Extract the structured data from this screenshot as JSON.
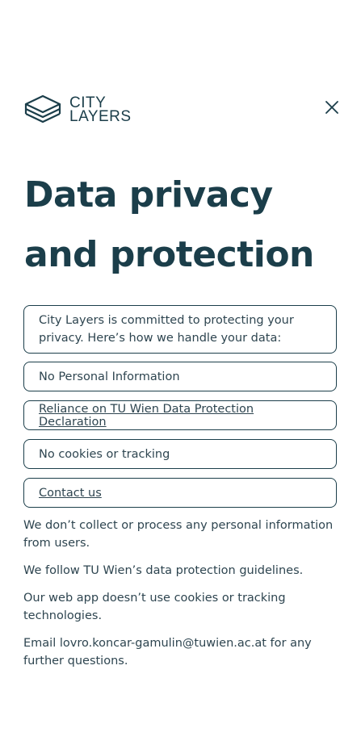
{
  "header": {
    "logo_line1": "CITY",
    "logo_line2": "LAYERS",
    "close_icon": "close-icon"
  },
  "title": "Data privacy and protection",
  "intro": "City Layers is committed to protecting your privacy. Here’s how we handle your data:",
  "cards": [
    {
      "label": "No Personal Information",
      "link": false
    },
    {
      "label": "Reliance on TU Wien Data Protection Declaration",
      "link": true
    },
    {
      "label": "No cookies or tracking",
      "link": false
    },
    {
      "label": "Contact us",
      "link": true
    }
  ],
  "paragraphs": [
    "We don’t collect or process any personal information from users.",
    "We follow TU Wien’s data protection guidelines.",
    "Our web app doesn’t use cookies or tracking technologies.",
    "Email lovro.koncar-gamulin@tuwien.ac.at for any further questions."
  ],
  "colors": {
    "primary": "#1b3e4a",
    "text": "#2e4550",
    "background": "#ffffff"
  }
}
